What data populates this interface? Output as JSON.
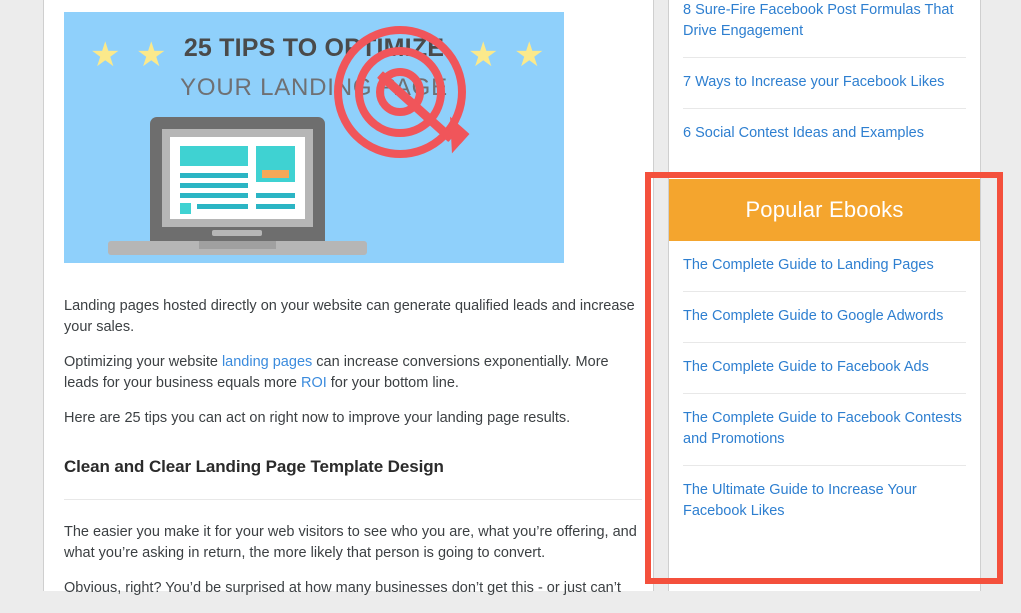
{
  "hero": {
    "title": "25 TIPS TO OPTIMIZE",
    "subtitle": "YOUR LANDING PAGE",
    "star_glyph": "★",
    "graphic_names": [
      "laptop-illustration",
      "target-bullseye-illustration"
    ],
    "colors": {
      "background": "#8fd0fb",
      "star": "#fbe98b",
      "accent_teal": "#3fd2d2",
      "accent_orange": "#f5a858",
      "accent_red": "#f0555a",
      "laptop_gray": "#6e6e6e"
    }
  },
  "article": {
    "paragraph_1": "Landing pages hosted directly on your website can generate qualified leads and increase your sales.",
    "paragraph_2_pre": "Optimizing your website ",
    "paragraph_2_link_1": "landing pages",
    "paragraph_2_mid": " can increase conversions exponentially. More leads for your business equals more ",
    "paragraph_2_link_2": "ROI",
    "paragraph_2_post": " for your bottom line.",
    "paragraph_3": "Here are 25 tips you can act on right now to improve your landing page results.",
    "heading_1": "Clean and Clear Landing Page Template Design",
    "paragraph_4": "The easier you make it for your web visitors to see who you are, what you’re offering, and what you’re asking in return, the  more likely that person is going to convert.",
    "paragraph_5": "Obvious, right? You’d be surprised at how many businesses don’t get this - or just can’t",
    "link_color": "#3b8bdd"
  },
  "sidebar": {
    "popular_posts": [
      "8 Sure-Fire Facebook Post Formulas That Drive Engagement",
      "7 Ways to Increase your Facebook Likes",
      "6 Social Contest Ideas and Examples"
    ],
    "ebooks_header": "Popular Ebooks",
    "ebooks_header_color": "#f4a52e",
    "ebooks": [
      "The Complete Guide to Landing Pages",
      "The Complete Guide to Google Adwords",
      "The Complete Guide to Facebook Ads",
      "The Complete Guide to Facebook Contests and Promotions",
      "The Ultimate Guide to Increase Your Facebook Likes"
    ],
    "link_color": "#2e7fd0"
  },
  "annotation": {
    "highlight_color": "#f4503c",
    "highlight_target": "Popular Ebooks widget"
  }
}
